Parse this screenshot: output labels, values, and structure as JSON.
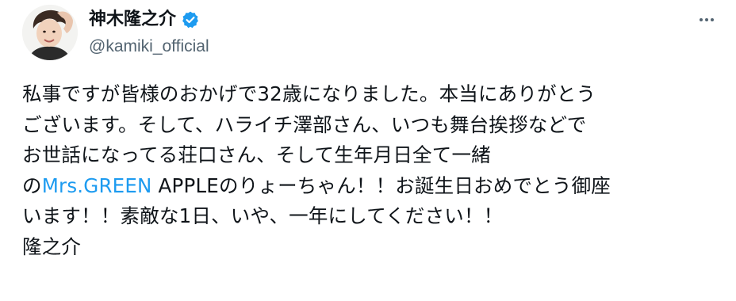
{
  "tweet": {
    "author": {
      "display_name": "神木隆之介",
      "handle": "@kamiki_official",
      "verified_icon": "verified-badge-icon",
      "avatar_icon": "avatar"
    },
    "more_icon": "more-options-icon",
    "text_lines": [
      {
        "parts": [
          "私事ですが皆様のおかげで32歳になりました。本当にありがとう"
        ]
      },
      {
        "parts": [
          "ございます。そして、ハライチ澤部さん、いつも舞台挨拶などで"
        ]
      },
      {
        "parts": [
          "お世話になってる荘口さん、そして生年月日全て一緒"
        ]
      },
      {
        "prefix": "の",
        "link": "Mrs.GREEN",
        "suffix": " APPLEのりょーちゃん！！お誕生日おめでとう御座"
      },
      {
        "parts": [
          "います！！素敵な1日、いや、一年にしてください！！"
        ]
      },
      {
        "parts": [
          "隆之介"
        ]
      }
    ],
    "colors": {
      "text": "#0f1419",
      "secondary": "#536471",
      "link": "#1d9bf0",
      "verified": "#1d9bf0"
    }
  }
}
